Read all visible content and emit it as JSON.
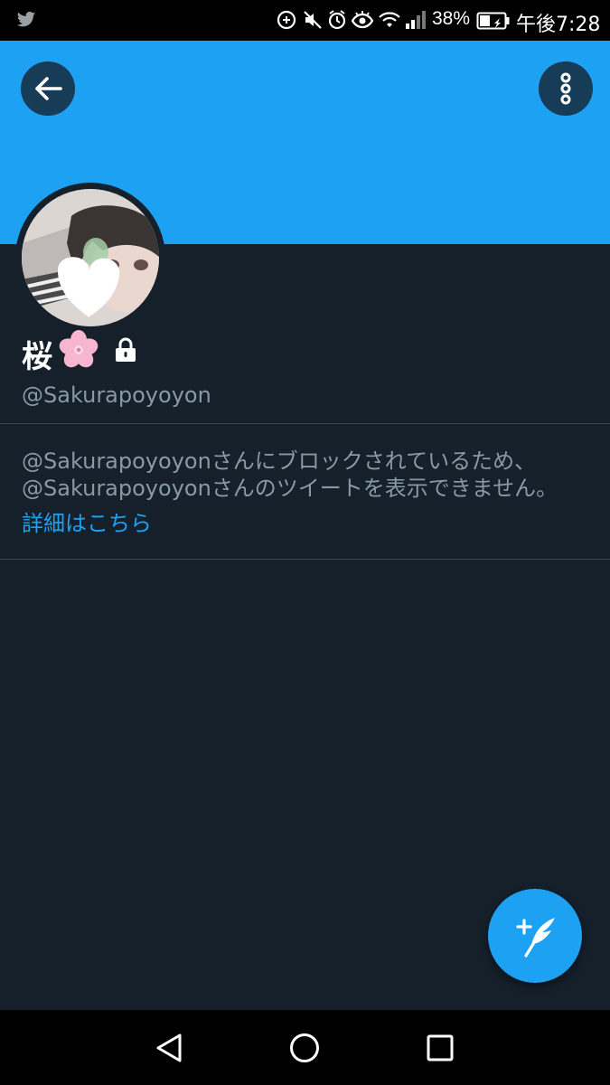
{
  "status_bar": {
    "battery_percent": "38%",
    "time": "午後7:28",
    "icons": [
      "twitter-bird-icon",
      "data-saver-icon",
      "mute-icon",
      "alarm-icon",
      "eye-comfort-icon",
      "wifi-icon",
      "signal-icon",
      "battery-icon"
    ]
  },
  "header": {
    "back_icon": "arrow-left-icon",
    "more_icon": "more-vertical-icon",
    "banner_color": "#1da1f2"
  },
  "profile": {
    "display_name": "桜",
    "name_emoji": "cherry-blossom-icon",
    "protected_icon": "lock-icon",
    "handle": "@Sakurapoyoyon"
  },
  "blocked_notice": {
    "line1": "@Sakurapoyoyonさんにブロックされているため、",
    "line2": "@Sakurapoyoyonさんのツイートを表示できません。",
    "learn_more": "詳細はこちら"
  },
  "fab": {
    "icon": "compose-tweet-icon"
  },
  "nav_bar": {
    "icons": [
      "nav-back-icon",
      "nav-home-icon",
      "nav-recents-icon"
    ]
  },
  "colors": {
    "background": "#15202b",
    "accent": "#1da1f2",
    "secondary_text": "#8899a6",
    "divider": "#38444d"
  }
}
